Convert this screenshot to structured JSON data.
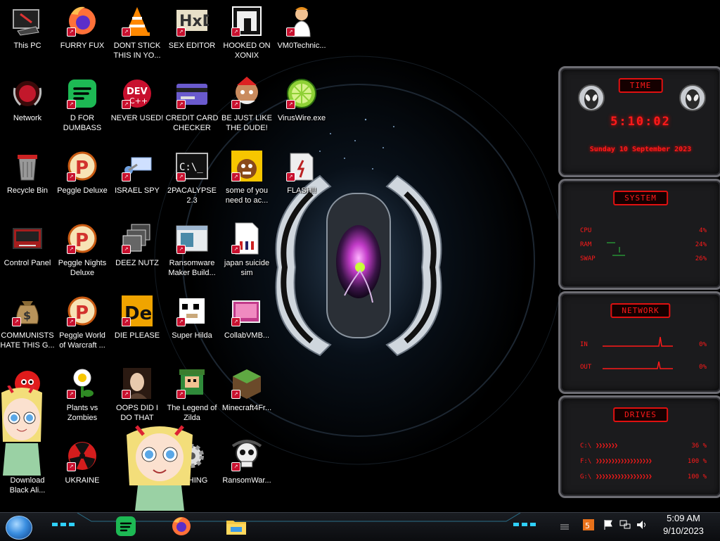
{
  "desktop": {
    "icons": [
      {
        "label": "This PC",
        "glyph": "this-pc"
      },
      {
        "label": "FURRY FUX",
        "glyph": "firefox"
      },
      {
        "label": "DONT STICK THIS IN YO...",
        "glyph": "vlc"
      },
      {
        "label": "SEX EDITOR",
        "glyph": "hxd"
      },
      {
        "label": "HOOKED ON XONIX",
        "glyph": "xonix"
      },
      {
        "label": "VM0Technic...",
        "glyph": "technician"
      },
      {
        "label": "Network",
        "glyph": "network"
      },
      {
        "label": "D FOR DUMBASS",
        "glyph": "spotify-like"
      },
      {
        "label": "NEVER USED!",
        "glyph": "devcpp"
      },
      {
        "label": "CREDIT CARD CHECKER",
        "glyph": "credit-card"
      },
      {
        "label": "BE JUST LIKE THE DUDE!",
        "glyph": "elf"
      },
      {
        "label": "VirusWire.exe",
        "glyph": "lime"
      },
      {
        "label": "Recycle Bin",
        "glyph": "recycle-bin"
      },
      {
        "label": "Peggle Deluxe",
        "glyph": "peggle"
      },
      {
        "label": "ISRAEL SPY",
        "glyph": "spy"
      },
      {
        "label": "2PACALYPSE 2.3",
        "glyph": "terminal"
      },
      {
        "label": "some of you need to ac...",
        "glyph": "bear"
      },
      {
        "label": "FLASH!!",
        "glyph": "flash"
      },
      {
        "label": "Control Panel",
        "glyph": "control-panel"
      },
      {
        "label": "Peggle Nights Deluxe",
        "glyph": "peggle"
      },
      {
        "label": "DEEZ NUTZ",
        "glyph": "windows-stack"
      },
      {
        "label": "Ransomware Maker Build...",
        "glyph": "window-app"
      },
      {
        "label": "japan suicide sim",
        "glyph": "doc"
      },
      {
        "label": "COMMUNISTS HATE THIS G...",
        "glyph": "money-bag"
      },
      {
        "label": "Peggle World of Warcraft ...",
        "glyph": "peggle"
      },
      {
        "label": "DIE PLEASE",
        "glyph": "de"
      },
      {
        "label": "Super Hilda",
        "glyph": "pixel-cat"
      },
      {
        "label": "CollabVMB...",
        "glyph": "collab"
      },
      {
        "label": "...IN",
        "glyph": "red-fluff"
      },
      {
        "label": "Plants vs Zombies",
        "glyph": "pvz"
      },
      {
        "label": "OOPS DID I DO THAT",
        "glyph": "portrait"
      },
      {
        "label": "The Legend of Zilda",
        "glyph": "zilda"
      },
      {
        "label": "Minecraft4Fr...",
        "glyph": "minecraft"
      },
      {
        "label": "Download Black Ali...",
        "glyph": "none"
      },
      {
        "label": "UKRAINE",
        "glyph": "radiation"
      },
      {
        "label": "...CHING",
        "glyph": "gear"
      },
      {
        "label": "RansomWar...",
        "glyph": "skull"
      }
    ]
  },
  "widget": {
    "time": {
      "header": "TIME",
      "clock": "5:10:02",
      "date": "Sunday 10 September 2023"
    },
    "system": {
      "header": "SYSTEM",
      "rows": [
        {
          "label": "CPU",
          "value": "4%"
        },
        {
          "label": "RAM",
          "value": "24%"
        },
        {
          "label": "SWAP",
          "value": "26%"
        }
      ]
    },
    "network": {
      "header": "NETWORK",
      "rows": [
        {
          "label": "IN",
          "value": "0%"
        },
        {
          "label": "OUT",
          "value": "0%"
        }
      ]
    },
    "drives": {
      "header": "DRIVES",
      "rows": [
        {
          "label": "C:\\",
          "value": "36 %"
        },
        {
          "label": "F:\\",
          "value": "100 %"
        },
        {
          "label": "G:\\",
          "value": "100 %"
        }
      ]
    }
  },
  "taskbar": {
    "apps": [
      "spotify",
      "firefox",
      "file-explorer"
    ],
    "clock": {
      "time": "5:09 AM",
      "date": "9/10/2023"
    }
  },
  "colors": {
    "accent_red": "#ff1a1a",
    "taskbar": "#0b0c0f"
  }
}
